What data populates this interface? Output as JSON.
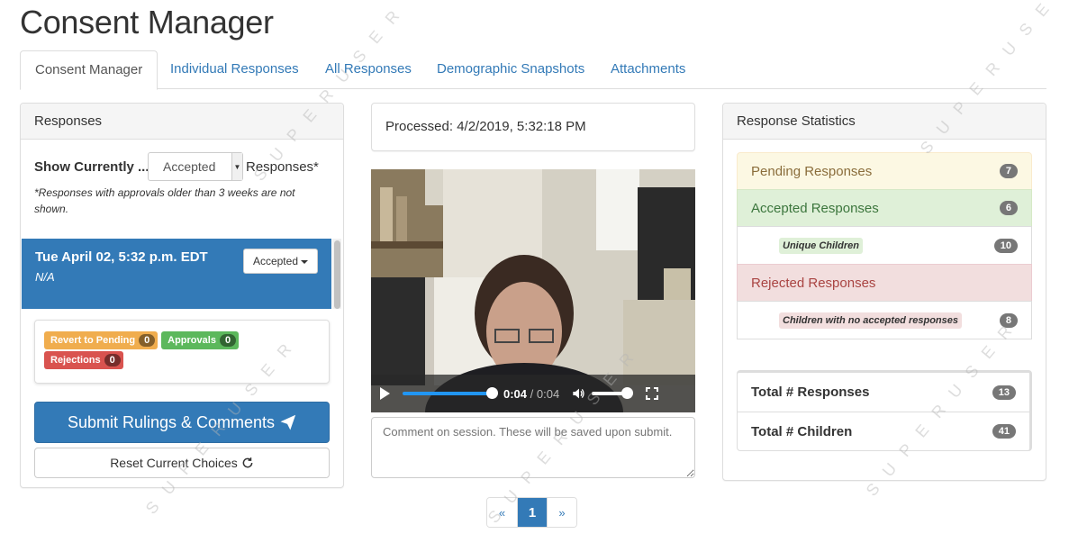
{
  "page_title": "Consent Manager",
  "tabs": [
    {
      "label": "Consent Manager"
    },
    {
      "label": "Individual Responses"
    },
    {
      "label": "All Responses"
    },
    {
      "label": "Demographic Snapshots"
    },
    {
      "label": "Attachments"
    }
  ],
  "responses_panel": {
    "heading": "Responses",
    "show_label": "Show Currently ...",
    "show_select_value": "Accepted",
    "show_suffix": "Responses*",
    "note": "*Responses with approvals older than 3 weeks are not shown.",
    "selected_response": {
      "date": "Tue April 02, 5:32 p.m. EDT",
      "sub": "N/A",
      "status_label": "Accepted"
    },
    "counts": [
      {
        "label": "Revert to Pending",
        "count": "0"
      },
      {
        "label": "Approvals",
        "count": "0"
      },
      {
        "label": "Rejections",
        "count": "0"
      }
    ],
    "submit_label": "Submit Rulings & Comments",
    "reset_label": "Reset Current Choices"
  },
  "processed_text": "Processed: 4/2/2019, 5:32:18 PM",
  "video": {
    "current_time": "0:04",
    "duration": "/ 0:04",
    "progress_fraction": 1.0
  },
  "comment_placeholder": "Comment on session. These will be saved upon submit.",
  "pagination": {
    "prev": "«",
    "current": "1",
    "next": "»"
  },
  "stats_panel": {
    "heading": "Response Statistics",
    "pending": {
      "label": "Pending Responses",
      "count": "7"
    },
    "accepted": {
      "label": "Accepted Responses",
      "count": "6"
    },
    "unique_children": {
      "label": "Unique Children",
      "count": "10"
    },
    "rejected": {
      "label": "Rejected Responses",
      "count": ""
    },
    "no_accepted": {
      "label": "Children with no accepted responses",
      "count": "8"
    },
    "total_responses": {
      "label": "Total # Responses",
      "count": "13"
    },
    "total_children": {
      "label": "Total # Children",
      "count": "41"
    }
  },
  "watermark_text": "SUPERUSER",
  "colors": {
    "primary": "#337ab7",
    "warning": "#f0ad4e",
    "success": "#5cb85c",
    "danger": "#d9534f"
  }
}
